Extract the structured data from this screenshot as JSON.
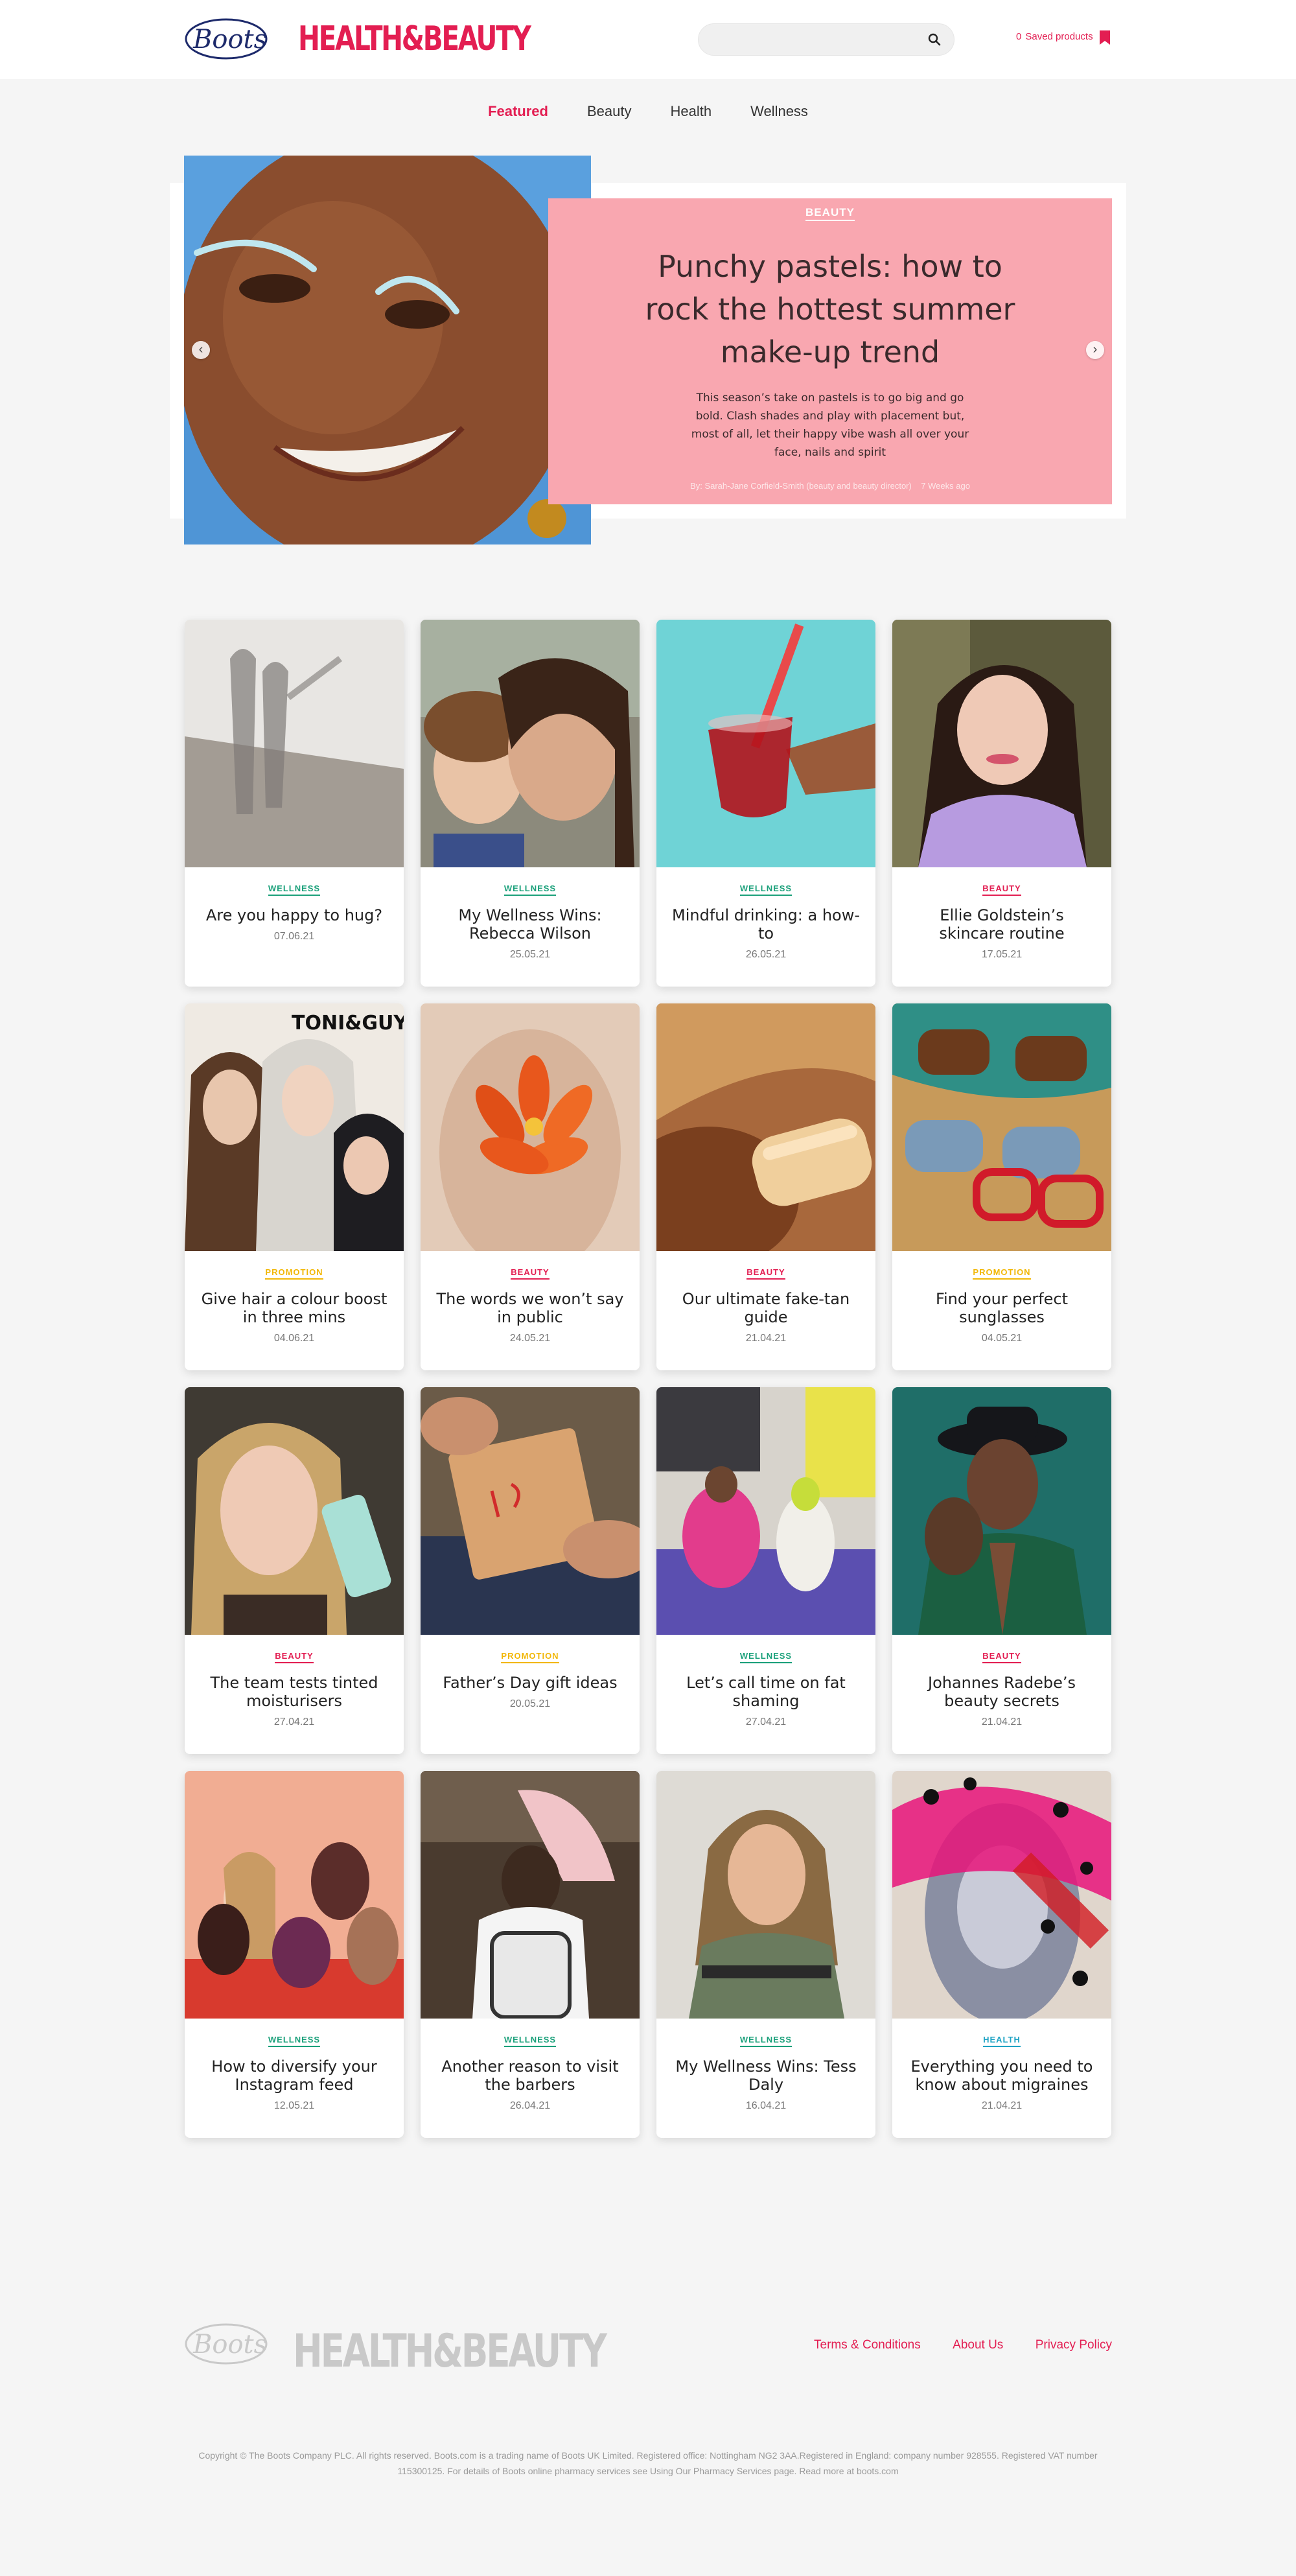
{
  "header": {
    "boots_logo_text": "Boots",
    "brand": "HEALTH&BEAUTY",
    "search_placeholder": "",
    "saved_count": "0",
    "saved_label": "Saved products"
  },
  "nav": [
    {
      "label": "Featured",
      "active": true
    },
    {
      "label": "Beauty",
      "active": false
    },
    {
      "label": "Health",
      "active": false
    },
    {
      "label": "Wellness",
      "active": false
    }
  ],
  "hero": {
    "category": "BEAUTY",
    "title": "Punchy pastels: how to rock the hottest summer make-up trend",
    "description": "This season’s take on pastels is to go big and go bold. Clash shades and play with placement but, most of all, let their happy vibe wash all over your face, nails and spirit",
    "byline": "By: Sarah-Jane Corfield-Smith (beauty and beauty director)",
    "time": "7 Weeks ago"
  },
  "cards": [
    {
      "category": "WELLNESS",
      "title": "Are you happy to hug?",
      "date": "07.06.21"
    },
    {
      "category": "WELLNESS",
      "title": "My Wellness Wins: Rebecca Wilson",
      "date": "25.05.21"
    },
    {
      "category": "WELLNESS",
      "title": "Mindful drinking: a how-to",
      "date": "26.05.21"
    },
    {
      "category": "BEAUTY",
      "title": "Ellie Goldstein’s skincare routine",
      "date": "17.05.21"
    },
    {
      "category": "PROMOTION",
      "title": "Give hair a colour boost in three mins",
      "date": "04.06.21"
    },
    {
      "category": "BEAUTY",
      "title": "The words we won’t say in public",
      "date": "24.05.21"
    },
    {
      "category": "BEAUTY",
      "title": "Our ultimate fake-tan guide",
      "date": "21.04.21"
    },
    {
      "category": "PROMOTION",
      "title": "Find your perfect sunglasses",
      "date": "04.05.21"
    },
    {
      "category": "BEAUTY",
      "title": "The team tests tinted moisturisers",
      "date": "27.04.21"
    },
    {
      "category": "PROMOTION",
      "title": "Father’s Day gift ideas",
      "date": "20.05.21"
    },
    {
      "category": "WELLNESS",
      "title": "Let’s call time on fat shaming",
      "date": "27.04.21"
    },
    {
      "category": "BEAUTY",
      "title": "Johannes Radebe’s beauty secrets",
      "date": "21.04.21"
    },
    {
      "category": "WELLNESS",
      "title": "How to diversify your Instagram feed",
      "date": "12.05.21"
    },
    {
      "category": "WELLNESS",
      "title": "Another reason to visit the barbers",
      "date": "26.04.21"
    },
    {
      "category": "WELLNESS",
      "title": "My Wellness Wins: Tess Daly",
      "date": "16.04.21"
    },
    {
      "category": "HEALTH",
      "title": "Everything you need to know about migraines",
      "date": "21.04.21"
    }
  ],
  "card_image_logo": "TONI&GUY",
  "footer": {
    "boots_logo_text": "Boots",
    "brand": "HEALTH&BEAUTY",
    "links": [
      "Terms & Conditions",
      "About Us",
      "Privacy Policy"
    ],
    "copyright": "Copyright © The Boots Company PLC. All rights reserved. Boots.com is a trading name of Boots UK Limited. Registered office: Nottingham NG2 3AA.Registered in England: company number 928555. Registered VAT number 115300125. For details of Boots online pharmacy services see Using Our Pharmacy Services page. Read more at boots.com"
  },
  "colors": {
    "brand_pink": "#e31e52",
    "hero_panel": "#f9a7b0",
    "wellness": "#1aa07a",
    "beauty": "#e31e52",
    "promotion": "#f2b705",
    "health": "#1fa3c4"
  }
}
